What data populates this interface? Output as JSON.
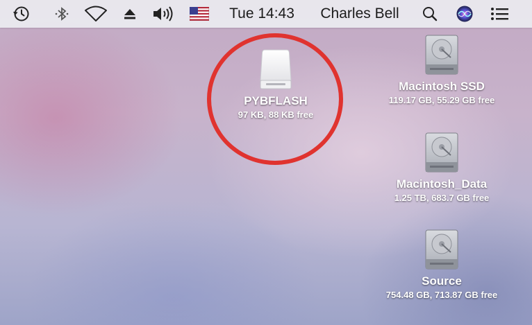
{
  "menubar": {
    "icons": [
      "time-machine-icon",
      "bluetooth-icon",
      "wifi-icon",
      "eject-icon",
      "volume-icon",
      "us-flag-icon",
      "spotlight-icon",
      "siri-icon",
      "notification-center-icon"
    ],
    "clock": "Tue 14:43",
    "user": "Charles Bell",
    "background_color": "#ececf0"
  },
  "desktop": {
    "drives": [
      {
        "name": "PYBFLASH",
        "info": "97 KB, 88 KB free",
        "type": "removable",
        "highlighted": true
      },
      {
        "name": "Macintosh SSD",
        "info": "119.17 GB, 55.29 GB free",
        "type": "internal"
      },
      {
        "name": "Macintosh_Data",
        "info": "1.25 TB, 683.7 GB free",
        "type": "internal"
      },
      {
        "name": "Source",
        "info": "754.48 GB, 713.87 GB free",
        "type": "internal"
      }
    ],
    "highlight_color": "#e0332f"
  }
}
